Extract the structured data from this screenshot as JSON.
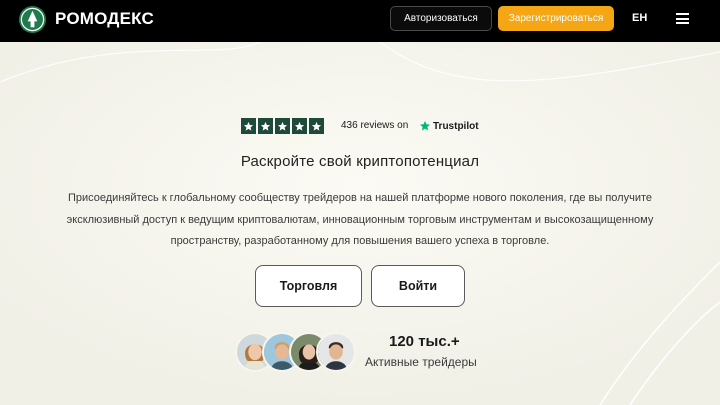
{
  "header": {
    "brand": "РОМОДЕКС",
    "login_label": "Авторизоваться",
    "register_label": "Зарегистрироваться",
    "lang_label": "EH",
    "logo_icon": "tree-logo-icon",
    "menu_icon": "hamburger-menu-icon"
  },
  "rating": {
    "stars": 5,
    "reviews_text": "436 reviews on",
    "provider": "Trustpilot"
  },
  "hero": {
    "headline": "Раскройте свой криптопотенциал",
    "description": "Присоединяйтесь к глобальному сообществу трейдеров на нашей платформе нового поколения, где вы получите эксклюзивный доступ к ведущим криптовалютам, инновационным торговым инструментам и высокозащищенному пространству, разработанному для повышения вашего успеха в торговле.",
    "trade_label": "Торговля",
    "enter_label": "Войти"
  },
  "traders": {
    "count": "120 тыс.+",
    "label": "Активные трейдеры"
  },
  "colors": {
    "header_bg": "#000000",
    "accent_orange": "#f5a614",
    "star_bg": "#1f4a3b",
    "page_bg": "#f6f5ee",
    "trustpilot_green": "#00b67a"
  }
}
